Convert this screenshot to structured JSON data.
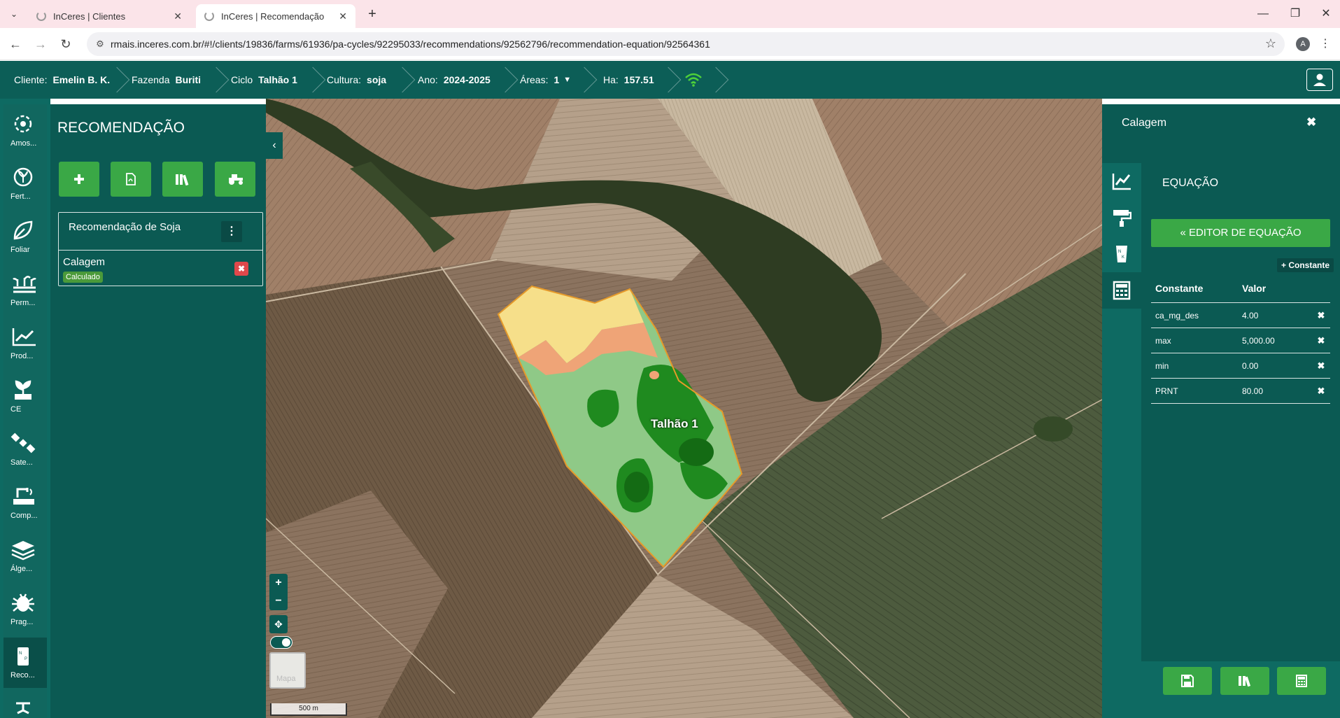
{
  "browser": {
    "tabs": [
      {
        "title": "InCeres | Clientes",
        "active": false
      },
      {
        "title": "InCeres | Recomendação",
        "active": true
      }
    ],
    "url": "rmais.inceres.com.br/#!/clients/19836/farms/61936/pa-cycles/92295033/recommendations/92562796/recommendation-equation/92564361",
    "profile_initial": "A"
  },
  "header": {
    "cliente_label": "Cliente:",
    "cliente_value": "Emelin B. K.",
    "fazenda_label": "Fazenda",
    "fazenda_value": "Buriti",
    "ciclo_label": "Ciclo",
    "ciclo_value": "Talhão 1",
    "cultura_label": "Cultura:",
    "cultura_value": "soja",
    "ano_label": "Ano:",
    "ano_value": "2024-2025",
    "areas_label": "Áreas:",
    "areas_value": "1",
    "ha_label": "Ha:",
    "ha_value": "157.51"
  },
  "rail": [
    {
      "label": "Amos...",
      "icon": "sampling-icon"
    },
    {
      "label": "Fert...",
      "icon": "fertility-icon"
    },
    {
      "label": "Foliar",
      "icon": "leaf-icon"
    },
    {
      "label": "Perm...",
      "icon": "permanent-crop-icon"
    },
    {
      "label": "Prod...",
      "icon": "productivity-chart-icon"
    },
    {
      "label": "CE",
      "icon": "ce-plant-icon"
    },
    {
      "label": "Sate...",
      "icon": "satellite-icon"
    },
    {
      "label": "Comp...",
      "icon": "compaction-icon"
    },
    {
      "label": "Álge...",
      "icon": "layers-icon"
    },
    {
      "label": "Prag...",
      "icon": "bug-icon"
    },
    {
      "label": "Reco...",
      "icon": "recommendation-bag-icon"
    }
  ],
  "recommendation": {
    "title": "RECOMENDAÇÃO",
    "card_title": "Recomendação de Soja",
    "item_title": "Calagem",
    "item_status": "Calculado"
  },
  "map": {
    "field_label": "Talhão 1",
    "zoom_in": "+",
    "zoom_out": "−",
    "basemap_label": "Mapa",
    "scale_label": "500 m"
  },
  "panel": {
    "title": "Calagem",
    "section_title": "EQUAÇÃO",
    "editor_button": "« EDITOR DE EQUAÇÃO",
    "add_constant": "+ Constante",
    "col_constant": "Constante",
    "col_value": "Valor",
    "constants": [
      {
        "name": "ca_mg_des",
        "value": "4.00"
      },
      {
        "name": "max",
        "value": "5,000.00"
      },
      {
        "name": "min",
        "value": "0.00"
      },
      {
        "name": "PRNT",
        "value": "80.00"
      }
    ]
  },
  "colors": {
    "header_bg": "#0c5e57",
    "panel_bg": "#0b5a53",
    "accent_green": "#3aa846",
    "danger": "#e0484b"
  }
}
